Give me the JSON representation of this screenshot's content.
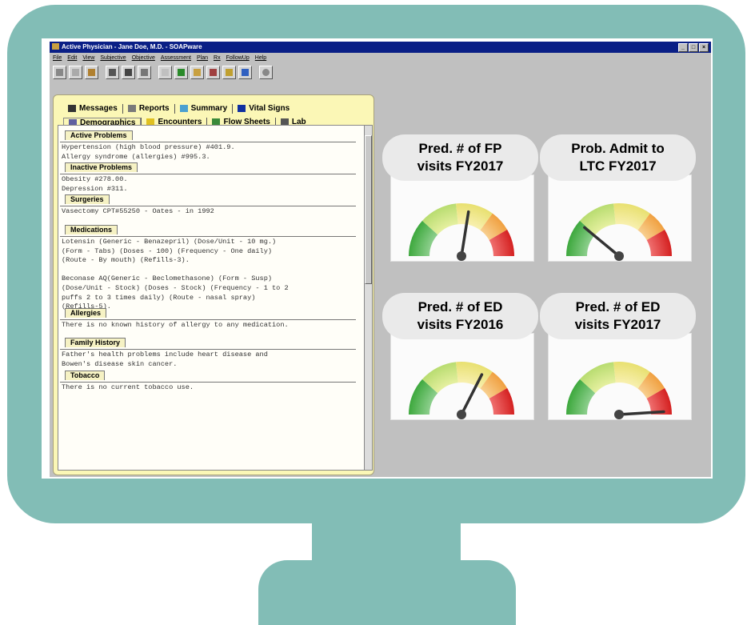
{
  "window": {
    "title": "Active Physician - Jane Doe, M.D. - SOAPware",
    "menu": [
      "File",
      "Edit",
      "View",
      "Subjective",
      "Objective",
      "Assessment",
      "Plan",
      "Rx",
      "FollowUp",
      "Help"
    ],
    "toolbar_icons": [
      "cut-icon",
      "copy-icon",
      "paste-icon",
      "print-icon",
      "filter-icon",
      "help-icon",
      "new-doc-icon",
      "save-icon",
      "folder-icon",
      "export-icon",
      "calendar-icon",
      "note-icon",
      "record-icon"
    ]
  },
  "tabs": {
    "row1": [
      {
        "label": "Messages",
        "icon": "phone-icon"
      },
      {
        "label": "Reports",
        "icon": "report-icon"
      },
      {
        "label": "Summary",
        "icon": "summary-icon"
      },
      {
        "label": "Vital Signs",
        "icon": "chart-icon"
      }
    ],
    "row2": [
      {
        "label": "Demographics",
        "icon": "person-icon"
      },
      {
        "label": "Encounters",
        "icon": "encounter-icon"
      },
      {
        "label": "Flow Sheets",
        "icon": "flow-icon"
      },
      {
        "label": "Lab",
        "icon": "lab-icon"
      }
    ]
  },
  "sections": [
    {
      "header": "Active Problems",
      "lines": [
        "Hypertension (high blood pressure) #401.9.",
        "Allergy syndrome (allergies) #995.3."
      ]
    },
    {
      "header": "Inactive Problems",
      "lines": [
        "Obesity #278.00.",
        "Depression #311."
      ]
    },
    {
      "header": "Surgeries",
      "lines": [
        "Vasectomy CPT#55250 - Oates - in 1992"
      ]
    },
    {
      "header": "Medications",
      "lines": [
        "Lotensin (Generic - Benazepril) (Dose/Unit - 10 mg.)",
        "(Form - Tabs) (Doses - 100) (Frequency - One daily)",
        "(Route - By mouth) (Refills-3).",
        "",
        "Beconase AQ(Generic - Beclomethasone) (Form - Susp)",
        "(Dose/Unit - Stock) (Doses - Stock) (Frequency - 1 to 2",
        "puffs 2 to 3 times daily) (Route - nasal spray)",
        "(Refills-5)."
      ]
    },
    {
      "header": "Allergies",
      "lines": [
        "There is no known history of allergy to any medication."
      ]
    },
    {
      "header": "Family History",
      "lines": [
        "Father's health problems include heart disease and",
        "Bowen's disease skin cancer."
      ]
    },
    {
      "header": "Tobacco",
      "lines": [
        "There is no current tobacco use."
      ]
    }
  ],
  "gauges": [
    {
      "line1": "Pred. # of FP",
      "line2": "visits  FY2017",
      "level": 0.55
    },
    {
      "line1": "Prob. Admit to",
      "line2": "LTC FY2017",
      "level": 0.22
    },
    {
      "line1": "Pred.  # of ED",
      "line2": "visits FY2016",
      "level": 0.65
    },
    {
      "line1": "Pred.  # of ED",
      "line2": "visits FY2017",
      "level": 0.98
    }
  ],
  "colors": {
    "monitor": "#82bdb6",
    "titlebar": "#0a1f86",
    "panel": "#fbf7b6",
    "gauge_green": "#3da83d",
    "gauge_yellow": "#e8e070",
    "gauge_orange": "#f0a040",
    "gauge_red": "#d42020"
  }
}
